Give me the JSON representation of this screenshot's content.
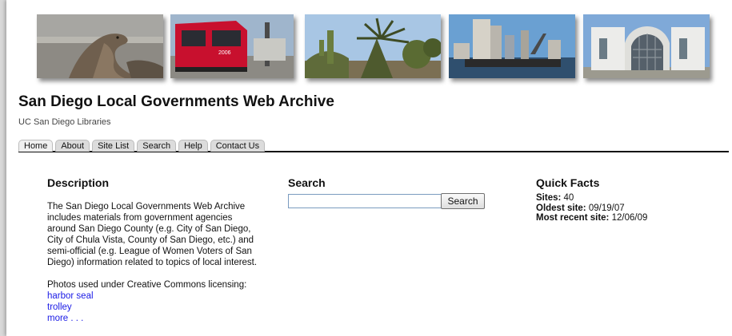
{
  "header": {
    "title": "San Diego Local Governments Web Archive",
    "subtitle": "UC San Diego Libraries"
  },
  "banner": {
    "photos": [
      {
        "icon": "harbor-seal-photo"
      },
      {
        "icon": "trolley-photo",
        "text": "2006"
      },
      {
        "icon": "cactus-garden-photo"
      },
      {
        "icon": "city-skyline-photo"
      },
      {
        "icon": "building-archway-photo"
      }
    ]
  },
  "nav": {
    "tabs": [
      {
        "label": "Home",
        "active": true
      },
      {
        "label": "About"
      },
      {
        "label": "Site List"
      },
      {
        "label": "Search"
      },
      {
        "label": "Help"
      },
      {
        "label": "Contact Us"
      }
    ]
  },
  "description": {
    "heading": "Description",
    "text": "The San Diego Local Governments Web Archive includes materials from government agencies around San Diego County (e.g. City of San Diego, City of Chula Vista, County of San Diego, etc.) and semi-official (e.g. League of Women Voters of San Diego) information related to topics of local interest.",
    "photos_note": "Photos used under Creative Commons licensing:",
    "links": [
      "harbor seal",
      "trolley",
      "more . . ."
    ]
  },
  "search": {
    "heading": "Search",
    "input_value": "",
    "button_label": "Search"
  },
  "quick_facts": {
    "heading": "Quick Facts",
    "sites_label": "Sites:",
    "sites_value": "40",
    "oldest_label": "Oldest site:",
    "oldest_value": "09/19/07",
    "recent_label": "Most recent site:",
    "recent_value": "12/06/09"
  },
  "colors": {
    "link": "#1a1ae6",
    "tab_bg": "#dcdcdc",
    "rule": "#111111"
  }
}
